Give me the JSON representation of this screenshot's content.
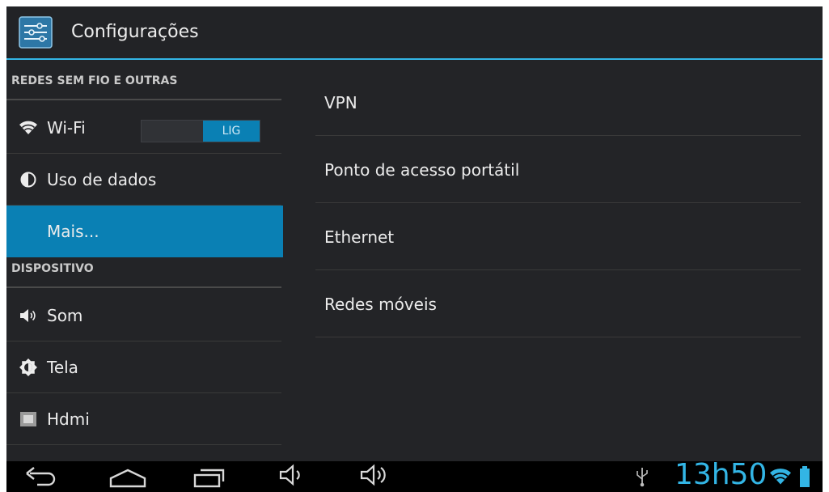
{
  "app": {
    "title": "Configurações"
  },
  "sidebar": {
    "section_wireless": "REDES SEM FIO E OUTRAS",
    "section_device": "DISPOSITIVO",
    "items": [
      {
        "label": "Wi-Fi",
        "icon": "wifi-icon",
        "toggle": "LIG"
      },
      {
        "label": "Uso de dados",
        "icon": "data-usage-icon"
      },
      {
        "label": "Mais...",
        "selected": true
      },
      {
        "label": "Som",
        "icon": "volume-icon"
      },
      {
        "label": "Tela",
        "icon": "brightness-icon"
      },
      {
        "label": "Hdmi",
        "icon": "hdmi-icon"
      }
    ]
  },
  "main": {
    "items": [
      {
        "label": "VPN"
      },
      {
        "label": "Ponto de acesso portátil"
      },
      {
        "label": "Ethernet"
      },
      {
        "label": "Redes móveis"
      }
    ]
  },
  "statusbar": {
    "time": "13h50",
    "icons": [
      "usb-icon",
      "wifi-signal-icon",
      "battery-icon"
    ]
  },
  "colors": {
    "accent": "#33b5e5",
    "selected": "#0a80b4",
    "background": "#232427"
  }
}
